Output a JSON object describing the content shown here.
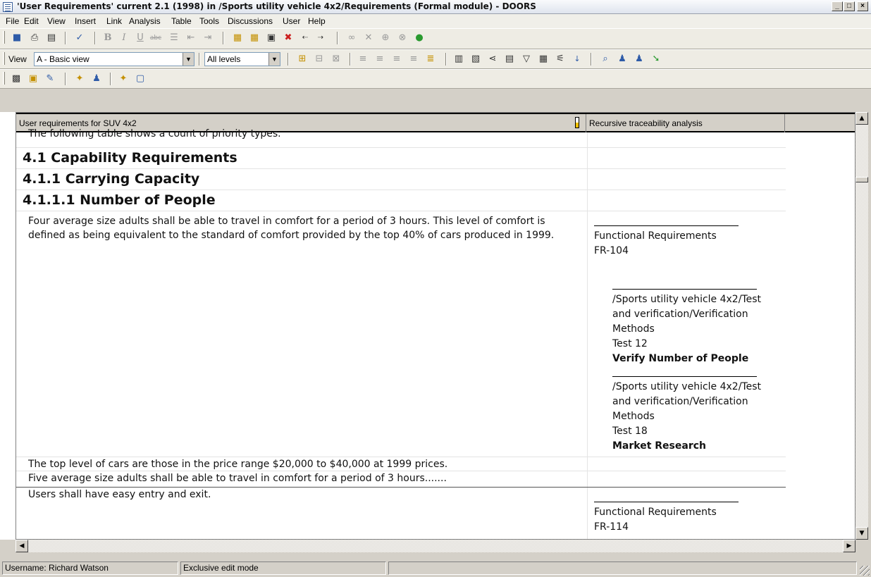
{
  "window": {
    "title": "'User Requirements' current 2.1 (1998) in /Sports utility vehicle 4x2/Requirements (Formal module) - DOORS",
    "minimize": "_",
    "maximize": "□",
    "close": "×"
  },
  "menu": [
    "File",
    "Edit",
    "View",
    "Insert",
    "Link",
    "Analysis",
    "Table",
    "Tools",
    "Discussions",
    "User",
    "Help"
  ],
  "toolbar2": {
    "view_label": "View",
    "view_value": "A - Basic view",
    "levels_value": "All levels"
  },
  "grid": {
    "columns": [
      "User requirements for SUV 4x2",
      "Recursive traceability analysis"
    ],
    "rows": {
      "intro": "The following table shows a count of priority types.",
      "h_41": "4.1 Capability Requirements",
      "h_411": "4.1.1 Carrying Capacity",
      "h_4111": "4.1.1.1 Number of People",
      "req_people": "Four average size adults shall be able to travel in comfort for a period of 3 hours. This level of comfort is defined as being equivalent to the standard of comfort provided by the top 40% of cars produced in 1999.",
      "top_level": "The top level of cars are those in the price range $20,000 to $40,000 at 1999 prices.",
      "five_adults": "Five average size adults shall be able to travel in comfort for a period of 3 hours.......",
      "entry_exit": "Users shall have easy entry and exit."
    },
    "trace": {
      "fr104_module": "Functional Requirements",
      "fr104_id": "FR-104",
      "test12_path": "/Sports utility vehicle 4x2/Test and verification/Verification Methods",
      "test12_id": "Test 12",
      "test12_title": "Verify Number of People",
      "test18_path": "/Sports utility vehicle 4x2/Test and verification/Verification Methods",
      "test18_id": "Test 18",
      "test18_title": "Market Research",
      "fr114_module": "Functional Requirements",
      "fr114_id": "FR-114"
    }
  },
  "status": {
    "username": "Username: Richard Watson",
    "mode": "Exclusive edit mode"
  }
}
